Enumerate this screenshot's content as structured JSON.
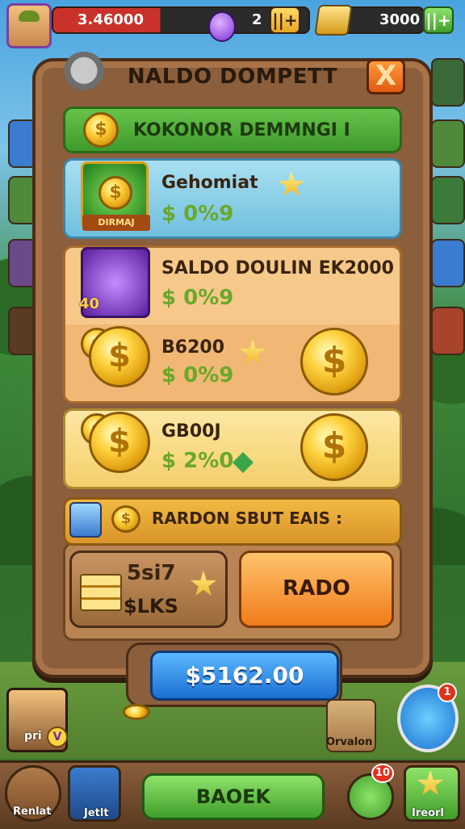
{
  "topbar": {
    "money_value": "3.46000",
    "money_count": "2",
    "gold_value": "3000"
  },
  "panel": {
    "title": "NALDO DOMPETT",
    "close_label": "X",
    "header_label": "KOKONOR DEMMNGI I"
  },
  "offers": [
    {
      "name": "Gehomiat",
      "price": "$ 0%9",
      "badge": "DIRMAJ"
    },
    {
      "name": "SALDO DOULIN EK2000",
      "price": "$ 0%9",
      "badge": "40"
    },
    {
      "name": "B6200",
      "price": "$ 0%9"
    },
    {
      "name": "GB00J",
      "price": "$ 2%0"
    }
  ],
  "strip": {
    "label": "RARDON SBUT EAIS :"
  },
  "buttons": {
    "slks_top": "5si7",
    "slks_bottom": "$LKS",
    "orange": "RADO",
    "total": "$5162.00",
    "back": "BAOEK"
  },
  "bottom": {
    "hero_label": "pri",
    "cannon_label": "Orvalon",
    "feather_notif": "1",
    "nav_left_label": "Renlat",
    "nav_mid_label": "Jetlt",
    "nav_refresh_notif": "10",
    "nav_right_label": "Ireorl"
  },
  "colors": {
    "panel_wood": "#8b5e3c",
    "header_green": "#4fae35",
    "price_green": "#6aa82a",
    "total_blue": "#1c6fd1",
    "orange_btn": "#f07b1a"
  }
}
